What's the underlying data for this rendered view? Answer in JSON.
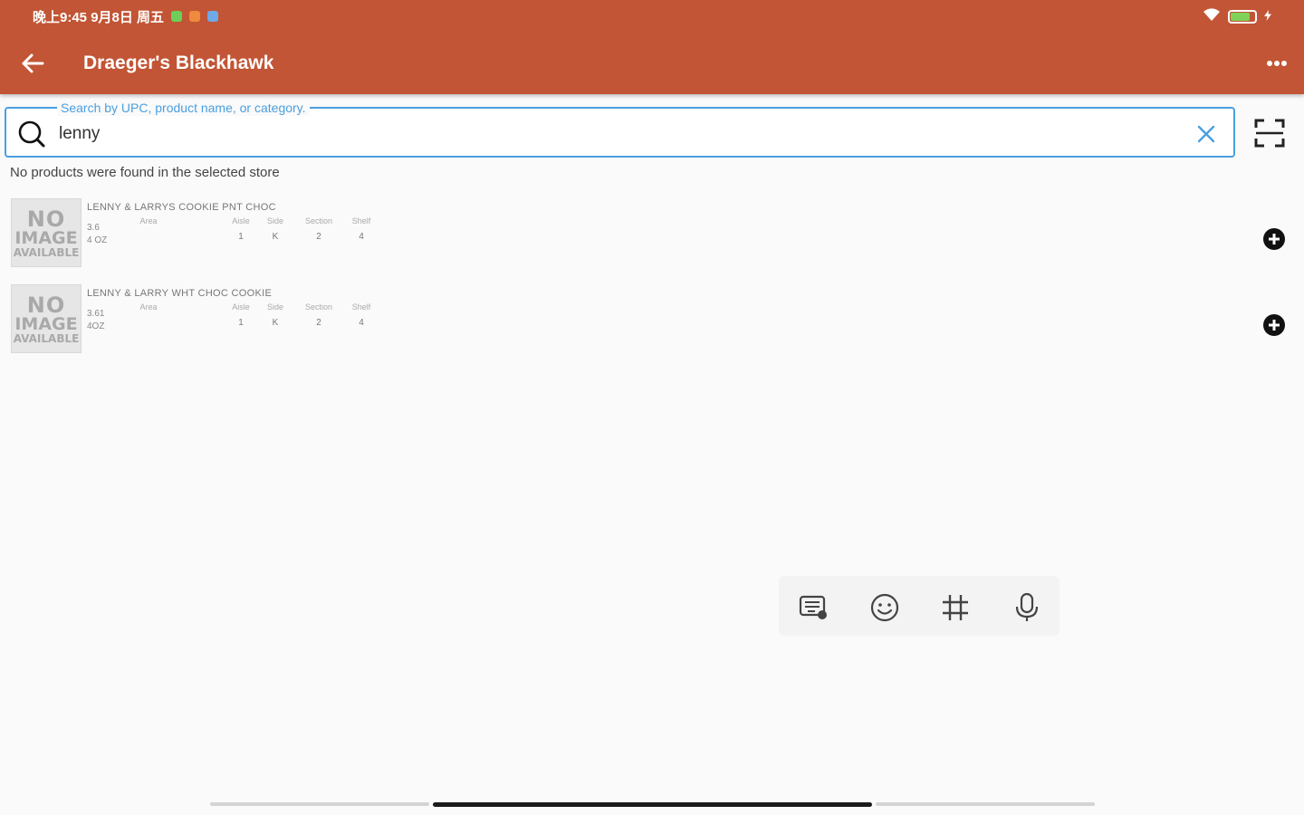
{
  "status_bar": {
    "time_text": "晚上9:45 9月8日 周五",
    "dot_colors": [
      "#6bcf5a",
      "#f08a3c",
      "#6ea9e8"
    ],
    "battery_text": "",
    "battery_level": 0.8,
    "battery_color": "#7fd35b"
  },
  "app_bar": {
    "title": "Draeger's Blackhawk",
    "back_icon": "arrow-left-icon",
    "more_icon": "more-horizontal-icon",
    "color": "#c25535"
  },
  "search": {
    "label": "Search by UPC, product name, or category.",
    "value": "lenny",
    "placeholder": "",
    "accent_color": "#4a9fe0",
    "scan_icon": "barcode-scan-icon"
  },
  "message": "No products were found in the selected store",
  "products": [
    {
      "image_lines": [
        "NO",
        "IMAGE",
        "AVAILABLE"
      ],
      "name": "LENNY & LARRYS COOKIE PNT CHOC",
      "size_line1": "3.6",
      "size_line2": "4 OZ",
      "columns": [
        {
          "header": "Area",
          "value": ""
        },
        {
          "header": "Aisle",
          "value": "1"
        },
        {
          "header": "Side",
          "value": "K"
        },
        {
          "header": "Section",
          "value": "2"
        },
        {
          "header": "Shelf",
          "value": "4"
        }
      ]
    },
    {
      "image_lines": [
        "NO",
        "IMAGE",
        "AVAILABLE"
      ],
      "name": "LENNY & LARRY WHT CHOC COOKIE",
      "size_line1": "3.61",
      "size_line2": "4OZ",
      "columns": [
        {
          "header": "Area",
          "value": ""
        },
        {
          "header": "Aisle",
          "value": "1"
        },
        {
          "header": "Side",
          "value": "K"
        },
        {
          "header": "Section",
          "value": "2"
        },
        {
          "header": "Shelf",
          "value": "4"
        }
      ]
    }
  ],
  "keyboard_toolbar": [
    "keyboard-settings-icon",
    "emoji-icon",
    "hashtag-icon",
    "microphone-icon"
  ]
}
